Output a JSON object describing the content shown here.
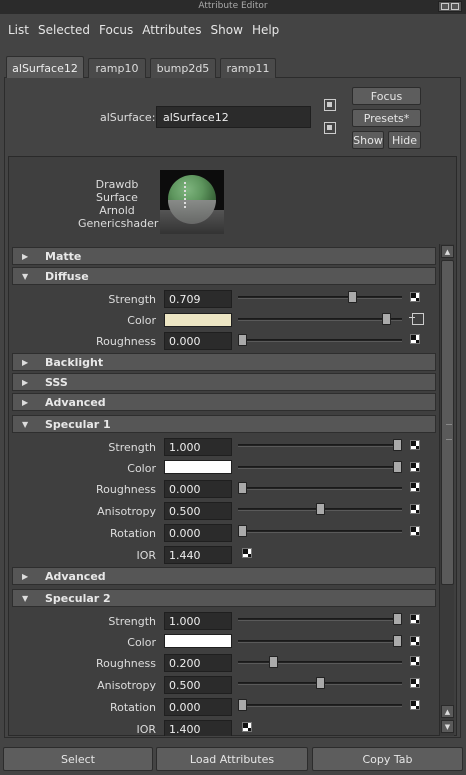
{
  "window": {
    "title": "Attribute Editor"
  },
  "menu": [
    "List",
    "Selected",
    "Focus",
    "Attributes",
    "Show",
    "Help"
  ],
  "tabs": [
    {
      "label": "alSurface12",
      "active": true
    },
    {
      "label": "ramp10",
      "active": false
    },
    {
      "label": "bump2d5",
      "active": false
    },
    {
      "label": "ramp11",
      "active": false
    }
  ],
  "node": {
    "type_label": "alSurface:",
    "name": "alSurface12",
    "focus_label": "Focus",
    "presets_label": "Presets*",
    "show_label": "Show",
    "hide_label": "Hide"
  },
  "swatch": {
    "label": "Drawdb Surface Arnold Genericshader"
  },
  "sections": {
    "matte": {
      "label": "Matte",
      "expanded": false
    },
    "diffuse": {
      "label": "Diffuse",
      "expanded": true,
      "strength": {
        "label": "Strength",
        "value": "0.709",
        "slider": 0.709
      },
      "color": {
        "label": "Color",
        "hex": "#ede6c4",
        "slider": 0.93
      },
      "roughness": {
        "label": "Roughness",
        "value": "0.000",
        "slider": 0.0
      }
    },
    "backlight": {
      "label": "Backlight",
      "expanded": false
    },
    "sss": {
      "label": "SSS",
      "expanded": false
    },
    "advanced1": {
      "label": "Advanced",
      "expanded": false
    },
    "specular1": {
      "label": "Specular 1",
      "expanded": true,
      "strength": {
        "label": "Strength",
        "value": "1.000",
        "slider": 1.0
      },
      "color": {
        "label": "Color",
        "hex": "#ffffff",
        "slider": 1.0
      },
      "roughness": {
        "label": "Roughness",
        "value": "0.000",
        "slider": 0.0
      },
      "anisotropy": {
        "label": "Anisotropy",
        "value": "0.500",
        "slider": 0.5
      },
      "rotation": {
        "label": "Rotation",
        "value": "0.000",
        "slider": 0.0
      },
      "ior": {
        "label": "IOR",
        "value": "1.440"
      }
    },
    "advanced2": {
      "label": "Advanced",
      "expanded": false
    },
    "specular2": {
      "label": "Specular 2",
      "expanded": true,
      "strength": {
        "label": "Strength",
        "value": "1.000",
        "slider": 1.0
      },
      "color": {
        "label": "Color",
        "hex": "#ffffff",
        "slider": 1.0
      },
      "roughness": {
        "label": "Roughness",
        "value": "0.200",
        "slider": 0.2
      },
      "anisotropy": {
        "label": "Anisotropy",
        "value": "0.500",
        "slider": 0.5
      },
      "rotation": {
        "label": "Rotation",
        "value": "0.000",
        "slider": 0.0
      },
      "ior": {
        "label": "IOR",
        "value": "1.400"
      }
    }
  },
  "bottom": {
    "select_label": "Select",
    "load_label": "Load Attributes",
    "copy_label": "Copy Tab"
  },
  "icons": {
    "expand": "triangle-right-icon",
    "collapse": "triangle-down-icon",
    "map": "map-connect-icon",
    "checker": "checker-icon"
  }
}
